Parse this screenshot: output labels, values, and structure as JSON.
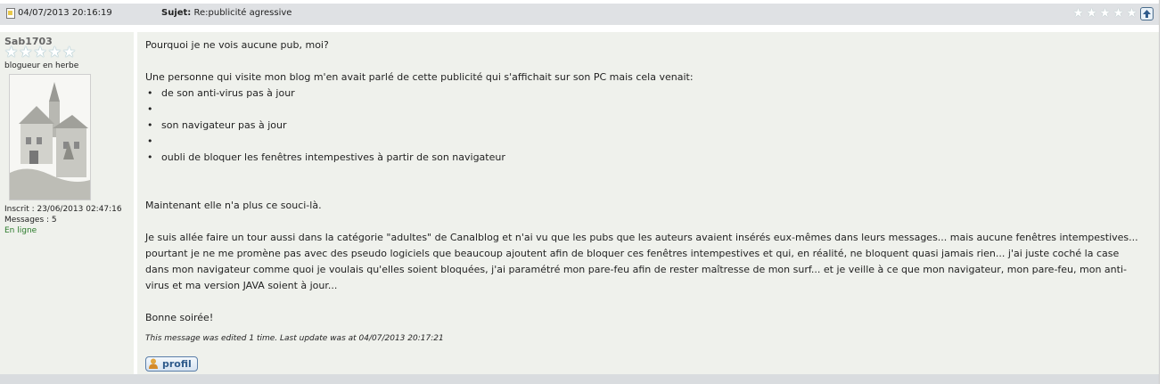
{
  "header": {
    "date": "04/07/2013 20:16:19",
    "subject_label": "Sujet:",
    "subject": "Re:publicité agressive"
  },
  "author": {
    "username": "Sab1703",
    "rank": "blogueur en herbe",
    "joined": "Inscrit : 23/06/2013 02:47:16",
    "messages": "Messages : 5",
    "status": "En ligne"
  },
  "post": {
    "line1": "Pourquoi je ne vois aucune pub, moi?",
    "line2": "Une personne qui visite mon blog m'en avait parlé de cette publicité qui s'affichait sur son PC mais cela venait:",
    "bullets": [
      "de son anti-virus pas à jour",
      "son navigateur pas à jour",
      "oubli de bloquer les fenêtres intempestives à partir de son navigateur"
    ],
    "line3": "Maintenant elle n'a plus ce souci-là.",
    "line4": "Je suis allée faire un tour aussi dans la catégorie \"adultes\" de Canalblog et n'ai vu que les pubs que les auteurs avaient insérés eux-mêmes dans leurs messages... mais aucune fenêtres intempestives... pourtant je ne me promène pas avec des pseudo logiciels que beaucoup ajoutent afin de bloquer ces fenêtres intempestives et qui, en réalité, ne bloquent quasi jamais rien... j'ai juste coché la case dans mon navigateur comme quoi je voulais qu'elles soient bloquées, j'ai paramétré mon pare-feu afin de rester maîtresse de mon surf... et je veille à ce que mon navigateur, mon pare-feu, mon anti-virus et ma version JAVA soient à jour...",
    "line5": "Bonne soirée!",
    "edited": "This message was edited 1 time. Last update was at 04/07/2013 20:17:21"
  },
  "buttons": {
    "profile": "profil"
  },
  "icons": {
    "post": "post-icon",
    "rating": "star-icon",
    "top": "arrow-up-icon",
    "profile": "user-icon"
  }
}
